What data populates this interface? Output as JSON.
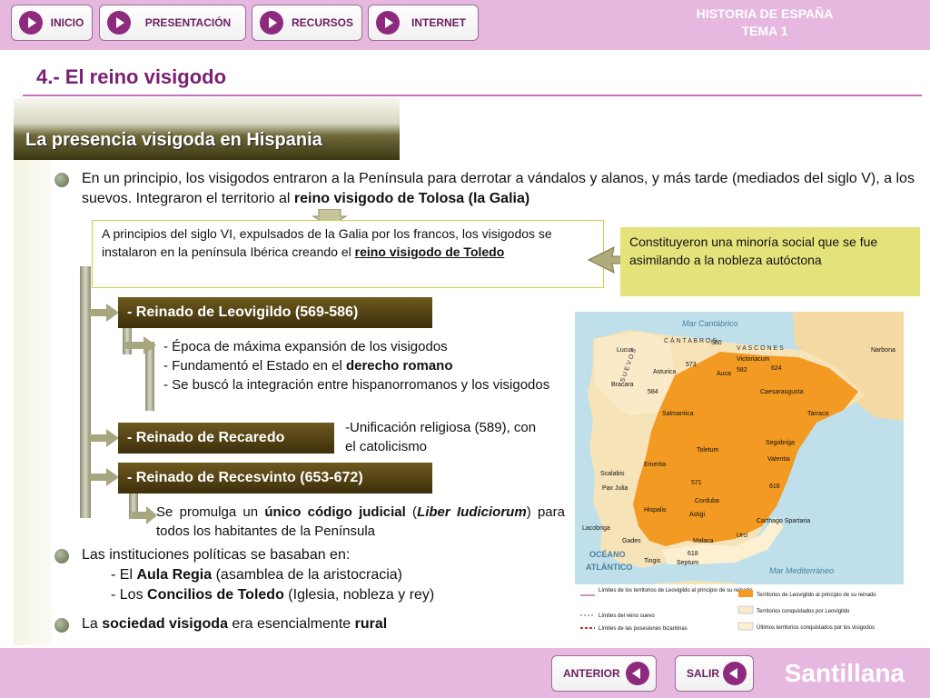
{
  "nav": {
    "inicio": "INICIO",
    "presentacion": "PRESENTACIÓN",
    "recursos": "RECURSOS",
    "internet": "INTERNET"
  },
  "header": {
    "title_line1": "HISTORIA DE ESPAÑA",
    "title_line2": "TEMA 1"
  },
  "section_title": "4.- El reino visigodo",
  "subtitle": "La presencia visigoda en Hispania",
  "intro": {
    "text": "En un principio, los visigodos entraron a la Península para derrotar a vándalos y alanos, y más tarde (mediados del siglo V), a los suevos. Integraron el territorio al ",
    "bold": "reino visigodo de Tolosa (la Galia)"
  },
  "callout_left": {
    "text": "A principios del siglo VI, expulsados de la Galia por los francos, los visigodos se instalaron en la península Ibérica creando el ",
    "bold": "reino visigodo de Toledo"
  },
  "callout_right": "Constituyeron una minoría social que se fue asimilando a la nobleza autóctona",
  "reigns": {
    "leovigildo": "- Reinado de Leovigildo (569-586)",
    "recaredo": "- Reinado de Recaredo",
    "recesvinto": "- Reinado de Recesvinto (653-672)"
  },
  "leovigildo_points": {
    "p1": "- Época de máxima expansión de los visigodos",
    "p2_pre": "- Fundamentó el Estado en el ",
    "p2_bold": "derecho romano",
    "p3": "- Se buscó la integración entre hispanorromanos y los visigodos"
  },
  "recaredo_point": "-Unificación religiosa (589), con el catolicismo",
  "recesvinto_point": {
    "pre": "Se promulga un ",
    "bold": "único código judicial",
    "mid": " (",
    "italic": "Liber Iudiciorum",
    "post": ") para todos los habitantes de la Península"
  },
  "institutions": {
    "intro": "Las instituciones políticas se basaban en:",
    "l1_pre": "- El ",
    "l1_bold": "Aula Regia",
    "l1_post": " (asamblea de la aristocracia)",
    "l2_pre": "- Los ",
    "l2_bold": "Concilios de Toledo",
    "l2_post": " (Iglesia, nobleza y rey)"
  },
  "society": {
    "pre": "La ",
    "bold1": "sociedad visigoda",
    "mid": " era esencialmente ",
    "bold2": "rural"
  },
  "map": {
    "sea_north": "Mar Cantábrico",
    "sea_med": "Mar Mediterráneo",
    "ocean_1": "OCÉANO",
    "ocean_2": "ATLÁNTICO",
    "peoples": [
      "C Á N T A B R O S",
      "V A S C O N E S",
      "S U E V O S"
    ],
    "cities": [
      "Lucus",
      "Asturica",
      "Bracara",
      "Salmantica",
      "Toletum",
      "Emerita",
      "Scalabis",
      "Pax Julia",
      "Hispalis",
      "Corduba",
      "Astigi",
      "Malaca",
      "Gades",
      "Tingis",
      "Septum",
      "Lacobriga",
      "Narbona",
      "Victoriacum",
      "Auca",
      "Caesaraugusta",
      "Tarraco",
      "Segobriga",
      "Valentia",
      "Carthago Spartaria",
      "Urci"
    ],
    "years": [
      "580",
      "573",
      "582",
      "624",
      "584",
      "571",
      "616",
      "618"
    ],
    "legend": [
      "Límites de los territorios de Leovigildo al principio de su reinado",
      "Límites del reino suevo",
      "Límites de las posesiones bizantinas",
      "Territorios de Leovigildo al principio de su reinado",
      "Territorios conquistados por Leovigildo",
      "Últimos territorios conquistados por los visigodos"
    ]
  },
  "footer": {
    "anterior": "ANTERIOR",
    "salir": "SALIR",
    "brand": "Santillana"
  }
}
